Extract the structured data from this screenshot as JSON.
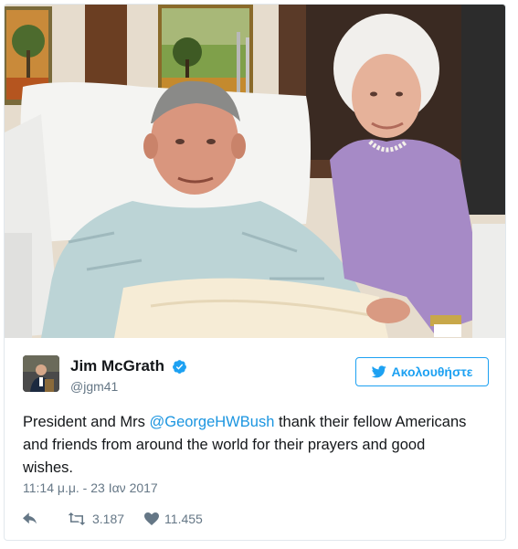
{
  "tweet": {
    "author": {
      "name": "Jim McGrath",
      "handle": "@jgm41",
      "verified": true
    },
    "follow_button": {
      "label": "Ακολουθήστε",
      "icon": "bird-icon"
    },
    "text": {
      "before": "President and Mrs ",
      "mention": "@GeorgeHWBush",
      "after": " thank their fellow Americans and friends from around the world for their prayers and good wishes."
    },
    "timestamp": "11:14 μ.μ. - 23 Ιαν 2017",
    "stats": {
      "retweets": "3.187",
      "likes": "11.455"
    },
    "icons": {
      "reply": "reply-icon",
      "retweet": "retweet-icon",
      "like": "heart-icon",
      "verified": "verified-badge-icon"
    },
    "colors": {
      "accent": "#1da1f2",
      "mention": "#1b95e0",
      "muted": "#657786",
      "text": "#14171a",
      "border": "#e1e8ed"
    }
  }
}
